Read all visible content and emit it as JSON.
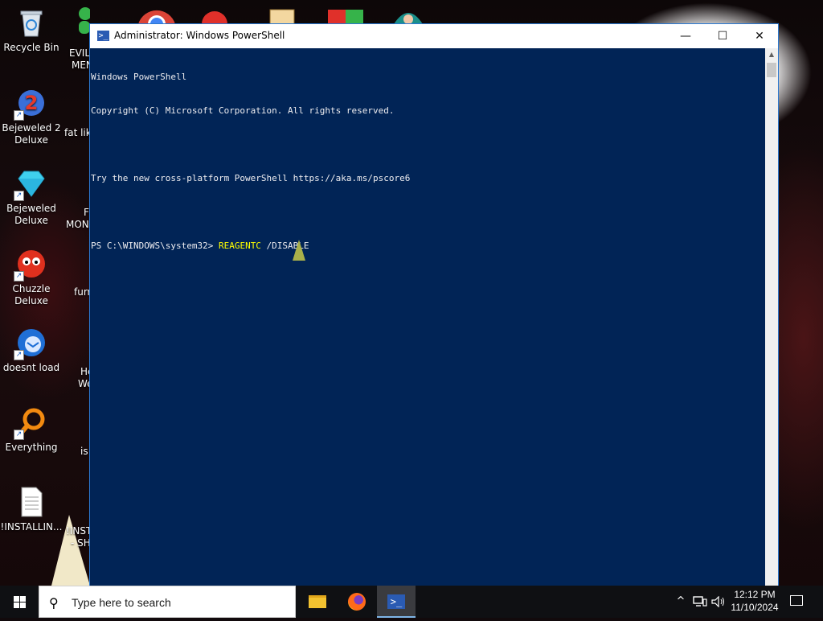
{
  "desktop": {
    "icons": [
      {
        "label": "Recycle Bin"
      },
      {
        "label": "Bejeweled 2 Deluxe"
      },
      {
        "label": "Bejeweled Deluxe"
      },
      {
        "label": "Chuzzle Deluxe"
      },
      {
        "label": "doesnt load"
      },
      {
        "label": "Everything"
      },
      {
        "label": "!INSTALLIN..."
      }
    ],
    "partial_labels": [
      "EVIL",
      "MEN",
      "fat like",
      "F",
      "MON",
      "furr",
      "He",
      "We",
      "is",
      "!INST",
      "- SH"
    ]
  },
  "window": {
    "title": "Administrator: Windows PowerShell",
    "minimize": "—",
    "maximize": "☐",
    "close": "✕",
    "console_lines": [
      "Windows PowerShell",
      "Copyright (C) Microsoft Corporation. All rights reserved.",
      "",
      "Try the new cross-platform PowerShell https://aka.ms/pscore6",
      ""
    ],
    "prompt": "PS C:\\WINDOWS\\system32> ",
    "command": "REAGENTC",
    "command_args": " /DISABLE",
    "colors": {
      "console_bg": "#012456",
      "text": "#eeedf0",
      "command": "#ffff00"
    }
  },
  "taskbar": {
    "search_placeholder": "Type here to search",
    "apps": [
      "folder-icon",
      "firefox-icon",
      "powershell-icon"
    ],
    "active_app": "powershell",
    "tray_icons": [
      "chevron-up-icon",
      "network-icon",
      "volume-icon"
    ],
    "time": "12:12 PM",
    "date": "11/10/2024"
  }
}
